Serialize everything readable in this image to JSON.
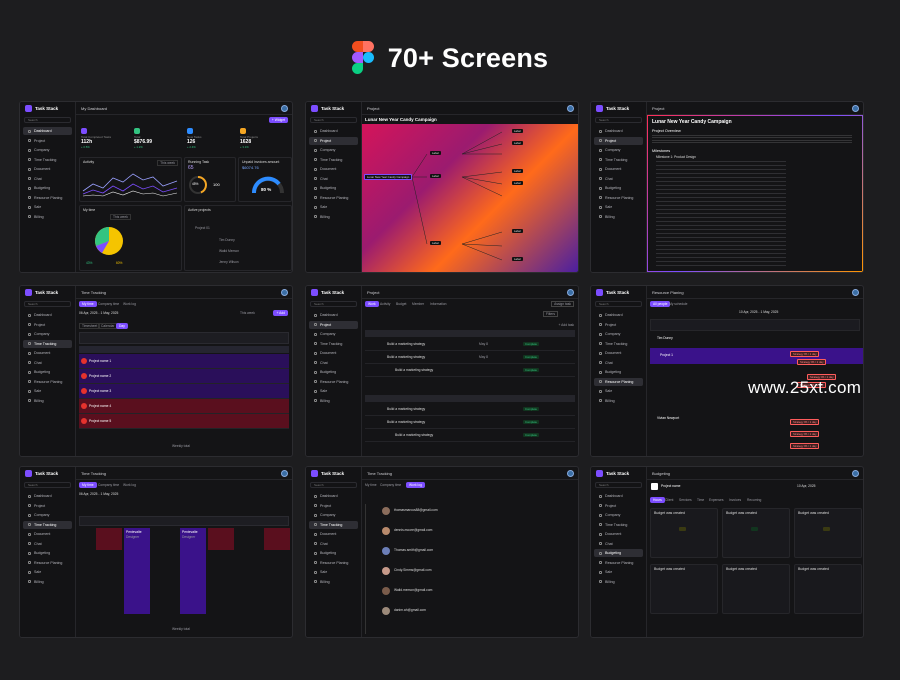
{
  "header": {
    "title": "70+ Screens"
  },
  "watermark": "www.25xt.com",
  "colors": {
    "accent": "#7c4dff",
    "background": "#1d1d1f",
    "panel": "#141416"
  },
  "brand": "Task Stack",
  "search_placeholder": "Search",
  "nav": [
    "Dashboard",
    "Project",
    "Company",
    "Time Tracking",
    "Document",
    "Chat",
    "Budgeting",
    "Resource Planing",
    "Sale",
    "Billing"
  ],
  "screens": {
    "dashboard": {
      "topbar": "My Dashboard",
      "add_widget": "+ Widget",
      "stats": [
        {
          "label": "Total Completed Tasks",
          "value": "112h",
          "change": "+ 0.5%"
        },
        {
          "label": "Total",
          "value": "$876.99",
          "change": "+ 1.2%"
        },
        {
          "label": "New Tasks",
          "value": "126",
          "change": "+ 2.4%"
        },
        {
          "label": "Total Projects",
          "value": "1628",
          "change": "+ 3.1%"
        }
      ],
      "activity": "Activity",
      "this_week": "This week",
      "running_task": "Running Task",
      "running_value": "65",
      "unpaid": "Unpaid invoices amount",
      "unpaid_value": "$6074.76",
      "gauge_value": "80 %",
      "percent_45": "45%",
      "hours_100": "100",
      "my_time": "My time",
      "active_projects": "Active projects",
      "project_name": "Project 01",
      "people": [
        "Tim Dunny",
        "Walid Memon",
        "Jenny Wilson"
      ],
      "legend": [
        "43%",
        "60%"
      ]
    },
    "mindmap": {
      "topbar": "Project",
      "title": "Lunar New Year Candy Campaign",
      "root": "Lunar New Year Candy Campaign",
      "node": "Label"
    },
    "doc": {
      "topbar": "Project",
      "title": "Lunar New Year Candy Campaign",
      "overview": "Project Overview",
      "milestones": "Milestones",
      "m1": "Milestone 1: Product Design"
    },
    "time_calendar": {
      "topbar": "Time Tracking",
      "tabs": [
        "My time",
        "Company time",
        "Work log"
      ],
      "range": "06 Apr, 2025 - 1 May, 2025",
      "this_week": "This week",
      "add": "+ Add",
      "views": [
        "Timesheet",
        "Calendar",
        "Day"
      ],
      "rows": [
        "Project name 1",
        "Project name 2",
        "Project name 3",
        "Project name 4",
        "Project name 5"
      ],
      "weekly_total": "Weekly total"
    },
    "tasks": {
      "topbar": "Project",
      "tabs": [
        "Work",
        "Activity",
        "Budget",
        "Member",
        "Information"
      ],
      "assign": "Assign task",
      "filters": "Filters",
      "add_task": "+ Add task",
      "task": "Build a marketing strategy",
      "status": "Complete",
      "due": "May 8"
    },
    "resource": {
      "topbar": "Resource Planing",
      "tabs": [
        "All people",
        "My schedule"
      ],
      "range": "10 Apr, 2025 - 1 May, 2025",
      "people": [
        "Tim Dunny",
        "Vivian Newport"
      ],
      "project": "Project 1",
      "bar": "Strategy 8h / 1 day"
    },
    "time_week": {
      "topbar": "Time Tracking",
      "tabs": [
        "My time",
        "Company time",
        "Work log"
      ],
      "range": "06 Apr, 2025 - 1 May, 2025",
      "weekly_total": "Weekly total",
      "cell": "Pentevalte",
      "cell_sub": "Designer"
    },
    "activity": {
      "topbar": "Time Tracking",
      "tabs": [
        "My time",
        "Company time",
        "Work log"
      ],
      "users": [
        "thomasmarcus88@gmail.com",
        "dennis.moore@gmail.com",
        "Thomas.smith@gmail.com",
        "Cindy.Simms@gmail.com",
        "Walid.memon@gmail.com",
        "danim.ah@gmail.com"
      ]
    },
    "budget": {
      "topbar": "Budgeting",
      "project": "Project name",
      "tabs": [
        "Hours",
        "Client",
        "Services",
        "Time",
        "Expenses",
        "Invoices",
        "Recurring"
      ],
      "card_title": "Budget was created",
      "range": "10 Apr, 2025"
    }
  }
}
